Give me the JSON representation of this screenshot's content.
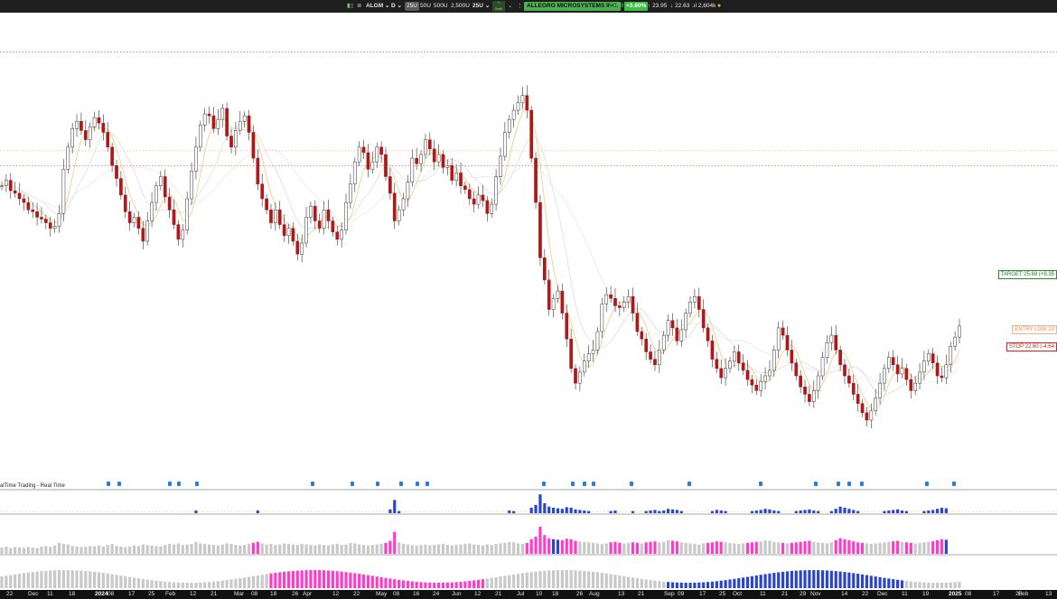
{
  "toolbar": {
    "symbol": "ALGM",
    "interval": "D",
    "range_buttons": [
      "25U",
      "50U",
      "500U",
      "2,500U"
    ],
    "range_active": "25U",
    "range_select": "25U",
    "strategy_label": "Swill",
    "company_name": "ALLEGRO MICROSYSTEMS INC.",
    "last_price": "23.79",
    "change_pct": "+3.80%",
    "high": "23.95",
    "low": "22.63",
    "volume": "2,604k",
    "colors": {
      "bg": "#1e1e1e",
      "company": "#4caf50",
      "up": "#3fbf3f",
      "status_dot": "#f5b800"
    }
  },
  "levels": {
    "target": "TARGET 25.68 (+8.35",
    "entry": "ENTRY LOW 23",
    "stop": "STOP 22.60 (-4.64"
  },
  "indicator_label": "alTime Trading - Real Time",
  "x_axis": {
    "labels": [
      {
        "t": "22"
      },
      {
        "t": "Dec"
      },
      {
        "t": "11"
      },
      {
        "t": "18"
      },
      {
        "t": "2024",
        "b": true
      },
      {
        "t": "08"
      },
      {
        "t": "17"
      },
      {
        "t": "25"
      },
      {
        "t": "Feb"
      },
      {
        "t": "12"
      },
      {
        "t": "21"
      },
      {
        "t": "Mar"
      },
      {
        "t": "08"
      },
      {
        "t": "18"
      },
      {
        "t": "26"
      },
      {
        "t": "Apr"
      },
      {
        "t": "12"
      },
      {
        "t": "22"
      },
      {
        "t": "May"
      },
      {
        "t": "08"
      },
      {
        "t": "16"
      },
      {
        "t": "24"
      },
      {
        "t": "Jun"
      },
      {
        "t": "12"
      },
      {
        "t": "21"
      },
      {
        "t": "Jul"
      },
      {
        "t": "10"
      },
      {
        "t": "18"
      },
      {
        "t": "26"
      },
      {
        "t": "Aug"
      },
      {
        "t": "13"
      },
      {
        "t": "21"
      },
      {
        "t": "Sep"
      },
      {
        "t": "09"
      },
      {
        "t": "17"
      },
      {
        "t": "25"
      },
      {
        "t": "Oct"
      },
      {
        "t": "11"
      },
      {
        "t": "21"
      },
      {
        "t": "29"
      },
      {
        "t": "Nov"
      },
      {
        "t": "14"
      },
      {
        "t": "22"
      },
      {
        "t": "Dec"
      },
      {
        "t": "11"
      },
      {
        "t": "19"
      },
      {
        "t": "2025",
        "b": true
      },
      {
        "t": "08"
      },
      {
        "t": "17"
      },
      {
        "t": "28"
      },
      {
        "t": "Feb"
      },
      {
        "t": "13"
      }
    ]
  },
  "chart_data": {
    "type": "candlestick",
    "colors": {
      "up": "#ffffff",
      "down": "#b01818",
      "ma1": "#f2c26b",
      "ma2": "#d8d8d8",
      "volume_up": "#2a45c8",
      "volume_down": "#ff3cc8",
      "volume_neutral": "#c8c8c8"
    },
    "close": [
      22.05,
      22.2,
      21.92,
      21.85,
      21.7,
      21.6,
      21.4,
      21.35,
      21.2,
      21.15,
      21.05,
      20.9,
      20.95,
      21.3,
      22.5,
      23.1,
      23.6,
      23.8,
      23.55,
      23.3,
      23.65,
      23.9,
      23.75,
      23.5,
      23.1,
      22.6,
      22.25,
      21.8,
      21.35,
      21.05,
      21.2,
      20.9,
      20.55,
      21.1,
      21.6,
      22.05,
      22.3,
      21.75,
      21.4,
      21.0,
      20.6,
      20.85,
      21.7,
      22.45,
      23.1,
      23.7,
      24.0,
      23.95,
      23.6,
      23.85,
      24.15,
      23.4,
      23.1,
      23.55,
      23.8,
      23.95,
      23.5,
      22.8,
      22.1,
      21.7,
      21.4,
      21.05,
      21.4,
      21.0,
      20.7,
      20.9,
      20.55,
      20.2,
      20.5,
      21.2,
      21.5,
      21.1,
      20.9,
      21.4,
      21.1,
      20.8,
      20.6,
      20.85,
      21.6,
      22.1,
      22.7,
      23.1,
      22.95,
      22.5,
      22.7,
      23.1,
      22.9,
      22.3,
      21.85,
      21.1,
      21.4,
      21.7,
      22.15,
      22.8,
      22.65,
      22.9,
      23.3,
      23.05,
      22.7,
      22.9,
      22.55,
      22.6,
      22.2,
      22.4,
      22.05,
      21.95,
      21.7,
      21.55,
      21.8,
      21.65,
      21.3,
      21.55,
      22.3,
      22.85,
      23.5,
      23.85,
      24.1,
      24.3,
      24.5,
      24.1,
      22.8,
      21.6,
      20.1,
      19.5,
      18.7,
      19.0,
      19.2,
      18.6,
      17.9,
      17.1,
      16.7,
      17.0,
      17.3,
      17.5,
      17.6,
      18.1,
      18.85,
      19.1,
      19.0,
      18.8,
      18.75,
      18.9,
      19.05,
      18.6,
      18.1,
      17.9,
      17.55,
      17.35,
      17.2,
      17.6,
      18.0,
      18.4,
      18.2,
      17.85,
      18.15,
      18.6,
      18.9,
      19.05,
      18.7,
      18.2,
      17.85,
      17.35,
      17.1,
      16.85,
      17.1,
      17.3,
      17.55,
      17.25,
      17.05,
      16.8,
      16.65,
      16.5,
      16.75,
      16.9,
      17.05,
      17.6,
      18.2,
      18.0,
      17.6,
      17.25,
      16.9,
      16.6,
      16.4,
      16.2,
      16.5,
      16.9,
      17.4,
      17.8,
      18.0,
      17.6,
      17.2,
      16.9,
      16.7,
      16.4,
      16.15,
      15.9,
      15.7,
      15.95,
      16.3,
      16.7,
      17.1,
      17.4,
      17.2,
      16.95,
      17.1,
      16.8,
      16.5,
      16.7,
      17.0,
      17.3,
      17.5,
      17.25,
      16.9,
      16.85,
      17.2,
      17.7,
      17.95,
      18.25
    ],
    "volume": [
      1200,
      1400,
      1100,
      1300,
      1250,
      1150,
      1300,
      1200,
      1100,
      1400,
      1500,
      1350,
      1600,
      2100,
      1900,
      1800,
      1500,
      1400,
      1300,
      1350,
      1500,
      1450,
      1600,
      1400,
      1700,
      1900,
      1500,
      1400,
      1300,
      1400,
      1600,
      1500,
      1800,
      1700,
      1600,
      1500,
      1450,
      1700,
      1900,
      1800,
      2000,
      1700,
      1800,
      1900,
      2300,
      2000,
      1900,
      1800,
      1700,
      1600,
      1800,
      2000,
      1900,
      1700,
      1600,
      1700,
      1900,
      2100,
      2300,
      2000,
      1800,
      1900,
      1700,
      1800,
      2000,
      1900,
      1800,
      1700,
      1900,
      1800,
      1700,
      1600,
      1800,
      1700,
      1600,
      1800,
      1900,
      1700,
      1800,
      2100,
      2000,
      1800,
      1700,
      1600,
      1700,
      1800,
      1900,
      2100,
      2500,
      4200,
      2200,
      1900,
      1800,
      1700,
      1600,
      1700,
      1800,
      1600,
      1700,
      1800,
      1900,
      1700,
      1600,
      1700,
      1800,
      1900,
      2000,
      1800,
      1700,
      1600,
      1800,
      1700,
      1900,
      2000,
      2100,
      2300,
      2200,
      2000,
      1900,
      2100,
      2800,
      3300,
      5200,
      3600,
      3000,
      2800,
      2700,
      2600,
      2900,
      2800,
      2500,
      2400,
      2300,
      2200,
      2100,
      2000,
      1900,
      2000,
      2200,
      2300,
      2100,
      2000,
      2100,
      2200,
      2100,
      2000,
      2200,
      2300,
      2400,
      2200,
      2300,
      2600,
      2500,
      2400,
      2200,
      2100,
      2000,
      1900,
      1800,
      2000,
      2100,
      2200,
      2400,
      2300,
      2200,
      2100,
      2000,
      1900,
      2000,
      2100,
      2200,
      2300,
      2400,
      2600,
      2500,
      2300,
      2200,
      2100,
      2000,
      2100,
      2200,
      2300,
      2400,
      2500,
      2300,
      2200,
      2100,
      2000,
      2200,
      2600,
      3000,
      2800,
      2600,
      2400,
      2200,
      2100,
      2000,
      1900,
      2000,
      2100,
      2200,
      2300,
      2400,
      2500,
      2300,
      2200,
      2100,
      2000,
      2100,
      2200,
      2300,
      2400,
      2600,
      2800,
      2700
    ],
    "y_axis": {
      "range": [
        14.5,
        26.5
      ]
    },
    "legend": "none",
    "grid": false
  }
}
